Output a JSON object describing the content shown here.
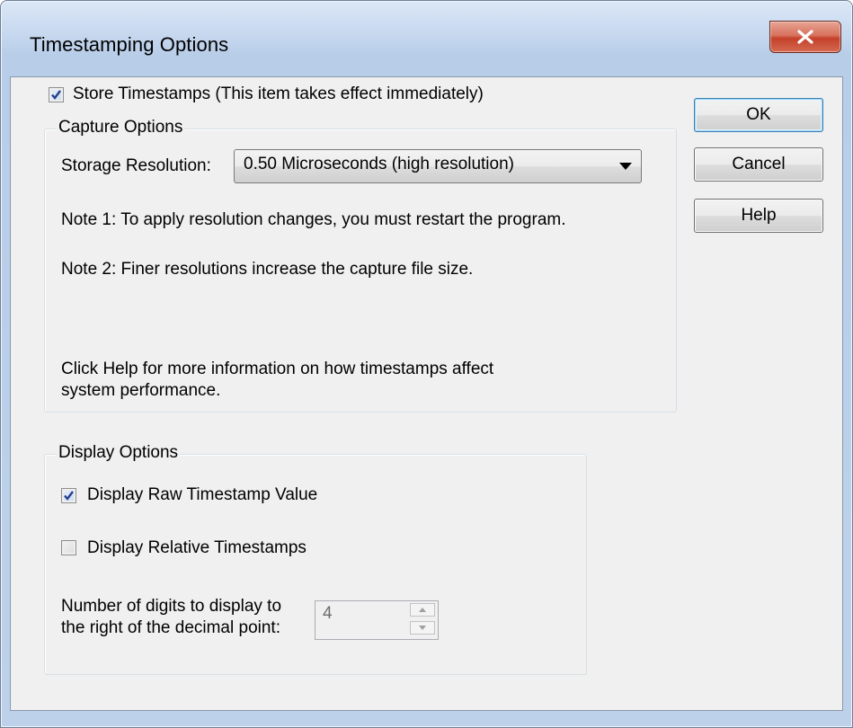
{
  "window": {
    "title": "Timestamping Options",
    "close_icon": "close-x-icon"
  },
  "store_timestamps": {
    "label": "Store Timestamps (This item takes effect immediately)",
    "checked": true
  },
  "capture_options": {
    "legend": "Capture Options",
    "storage_resolution_label": "Storage Resolution:",
    "storage_resolution_value": "0.50 Microseconds (high resolution)",
    "note1": "Note 1: To apply resolution changes, you must restart the program.",
    "note2": "Note 2: Finer resolutions increase the capture file size.",
    "help_line1": "Click Help for more information on how timestamps affect",
    "help_line2": "system performance."
  },
  "display_options": {
    "legend": "Display Options",
    "raw_label": "Display Raw Timestamp Value",
    "raw_checked": true,
    "relative_label": "Display Relative Timestamps",
    "relative_checked": false,
    "digits_label_line1": "Number of digits to display to",
    "digits_label_line2": "the right of the decimal point:",
    "digits_value": "4"
  },
  "buttons": {
    "ok": "OK",
    "cancel": "Cancel",
    "help": "Help"
  }
}
